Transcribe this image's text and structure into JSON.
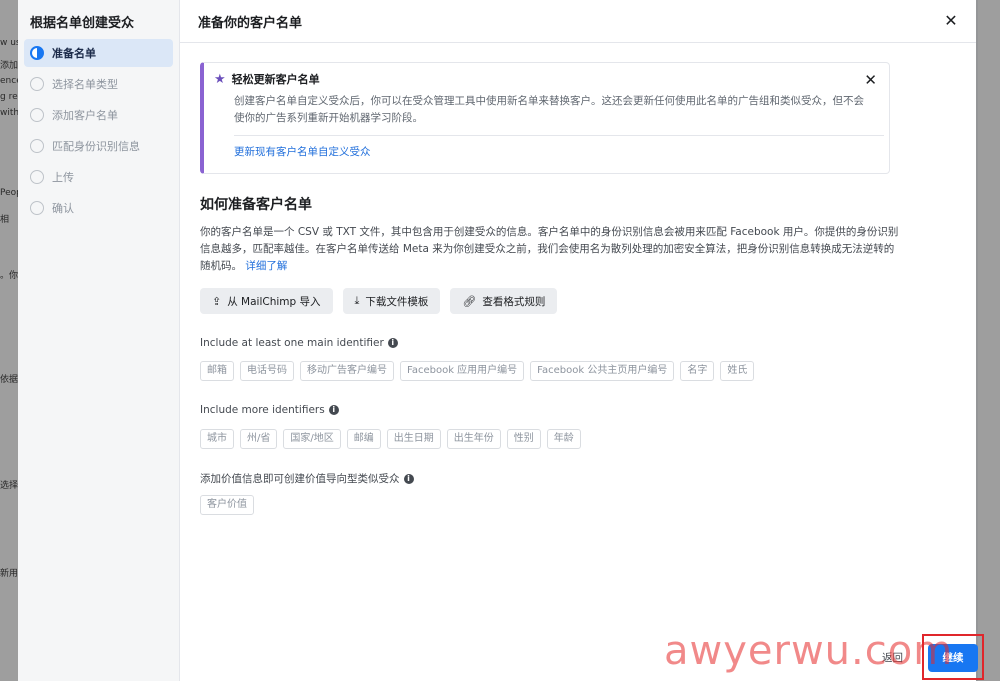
{
  "background": {
    "left_fragments": [
      "w us",
      "添加",
      "ence",
      "g re",
      "with",
      "Peop",
      "相",
      "。你",
      "依据",
      "选择",
      "新用"
    ]
  },
  "rail": {
    "title": "根据名单创建受众",
    "steps": [
      {
        "label": "准备名单",
        "active": true
      },
      {
        "label": "选择名单类型",
        "active": false
      },
      {
        "label": "添加客户名单",
        "active": false
      },
      {
        "label": "匹配身份识别信息",
        "active": false
      },
      {
        "label": "上传",
        "active": false
      },
      {
        "label": "确认",
        "active": false
      }
    ]
  },
  "header": {
    "title": "准备你的客户名单",
    "close_icon": "close-icon"
  },
  "notice": {
    "title": "轻松更新客户名单",
    "body": "创建客户名单自定义受众后，你可以在受众管理工具中使用新名单来替换客户。这还会更新任何使用此名单的广告组和类似受众，但不会使你的广告系列重新开始机器学习阶段。",
    "link": "更新现有客户名单自定义受众",
    "accent": "#8a63d2"
  },
  "section": {
    "title": "如何准备客户名单",
    "description": "你的客户名单是一个 CSV 或 TXT 文件，其中包含用于创建受众的信息。客户名单中的身份识别信息会被用来匹配 Facebook 用户。你提供的身份识别信息越多，匹配率越佳。在客户名单传送给 Meta 来为你创建受众之前，我们会使用名为散列处理的加密安全算法，把身份识别信息转换成无法逆转的随机码。",
    "learn_more": "详细了解"
  },
  "actions": [
    {
      "label": "从 MailChimp 导入",
      "icon": "import-icon"
    },
    {
      "label": "下载文件模板",
      "icon": "download-icon"
    },
    {
      "label": "查看格式规则",
      "icon": "link-icon"
    }
  ],
  "groups": {
    "main": {
      "label": "Include at least one main identifier",
      "chips": [
        "邮箱",
        "电话号码",
        "移动广告客户编号",
        "Facebook 应用用户编号",
        "Facebook 公共主页用户编号",
        "名字",
        "姓氏"
      ]
    },
    "more": {
      "label": "Include more identifiers",
      "chips": [
        "城市",
        "州/省",
        "国家/地区",
        "邮编",
        "出生日期",
        "出生年份",
        "性别",
        "年龄"
      ]
    },
    "value": {
      "label": "添加价值信息即可创建价值导向型类似受众",
      "chips": [
        "客户价值"
      ]
    }
  },
  "footer": {
    "back_label": "返回",
    "continue_label": "继续",
    "primary_color": "#1877f2",
    "highlight_color": "#e0262b"
  },
  "watermark": {
    "text": "awyerwu.com"
  }
}
